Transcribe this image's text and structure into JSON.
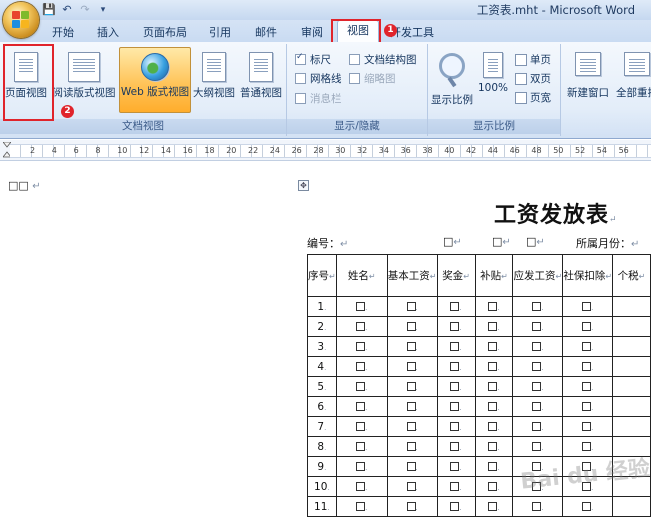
{
  "window": {
    "title": "工资表.mht - Microsoft Word",
    "quick_access": [
      "save",
      "undo",
      "redo"
    ]
  },
  "tabs": [
    {
      "label": "开始",
      "active": false
    },
    {
      "label": "插入",
      "active": false
    },
    {
      "label": "页面布局",
      "active": false
    },
    {
      "label": "引用",
      "active": false
    },
    {
      "label": "邮件",
      "active": false
    },
    {
      "label": "审阅",
      "active": false
    },
    {
      "label": "视图",
      "active": true
    },
    {
      "label": "开发工具",
      "active": false
    }
  ],
  "ribbon": {
    "doc_views": {
      "label": "文档视图",
      "buttons": [
        "页面视图",
        "阅读版式视图",
        "Web 版式视图",
        "大纲视图",
        "普通视图"
      ]
    },
    "show_hide": {
      "label": "显示/隐藏",
      "items": [
        {
          "label": "标尺",
          "checked": true,
          "enabled": true
        },
        {
          "label": "网格线",
          "checked": false,
          "enabled": true
        },
        {
          "label": "消息栏",
          "checked": false,
          "enabled": false
        },
        {
          "label": "文档结构图",
          "checked": false,
          "enabled": true
        },
        {
          "label": "缩略图",
          "checked": false,
          "enabled": true
        }
      ]
    },
    "zoom": {
      "label": "显示比例",
      "zoom_label": "显示比例",
      "percent_label": "100%",
      "single_page": "单页",
      "two_pages": "双页",
      "page_width": "页宽"
    },
    "window_group": {
      "new_window": "新建窗口",
      "arrange_all": "全部重排"
    }
  },
  "annotations": {
    "step1": "1",
    "step2": "2"
  },
  "ruler": {
    "numbers": [
      "2",
      "4",
      "6",
      "8",
      "10",
      "12",
      "14",
      "16",
      "18",
      "20",
      "22",
      "24",
      "26",
      "28",
      "30",
      "32",
      "34",
      "36",
      "38",
      "40",
      "42",
      "44",
      "46",
      "48",
      "50",
      "52",
      "54",
      "56"
    ]
  },
  "document": {
    "stray_text": "□□",
    "para_mark": "↵",
    "title": "工资发放表",
    "meta": {
      "number_label": "编号：",
      "box": "□",
      "month_label": "所属月份："
    },
    "table": {
      "headers": [
        "序号",
        "姓名",
        "基本工资",
        "奖金",
        "补贴",
        "应发工资",
        "社保扣除",
        "个税"
      ],
      "rows": [
        "1",
        "2",
        "3",
        "4",
        "5",
        "6",
        "7",
        "8",
        "9",
        "10",
        "11"
      ],
      "cell_mark": "□"
    }
  },
  "watermark": "Bai du 经验",
  "colors": {
    "annotation_red": "#e0242b",
    "ribbon_highlight": "#ffc45a",
    "tab_bar": "#c9dbf2"
  }
}
